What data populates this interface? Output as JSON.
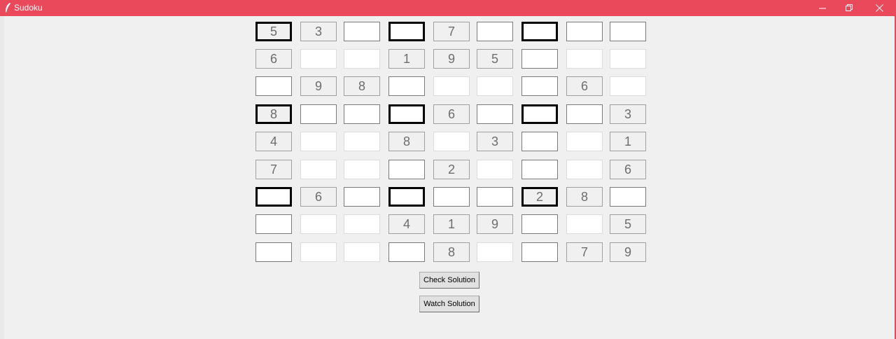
{
  "window": {
    "title": "Sudoku",
    "accent": "#e9495a"
  },
  "board": {
    "rows": [
      [
        "5",
        "3",
        "",
        "",
        "7",
        "",
        "",
        "",
        ""
      ],
      [
        "6",
        "",
        "",
        "1",
        "9",
        "5",
        "",
        "",
        ""
      ],
      [
        "",
        "9",
        "8",
        "",
        "",
        "",
        "",
        "6",
        ""
      ],
      [
        "8",
        "",
        "",
        "",
        "6",
        "",
        "",
        "",
        "3"
      ],
      [
        "4",
        "",
        "",
        "8",
        "",
        "3",
        "",
        "",
        "1"
      ],
      [
        "7",
        "",
        "",
        "",
        "2",
        "",
        "",
        "",
        "6"
      ],
      [
        "",
        "6",
        "",
        "",
        "",
        "",
        "2",
        "8",
        ""
      ],
      [
        "",
        "",
        "",
        "4",
        "1",
        "9",
        "",
        "",
        "5"
      ],
      [
        "",
        "",
        "",
        "",
        "8",
        "",
        "",
        "7",
        "9"
      ]
    ]
  },
  "buttons": {
    "check": "Check Solution",
    "watch": "Watch Solution"
  }
}
